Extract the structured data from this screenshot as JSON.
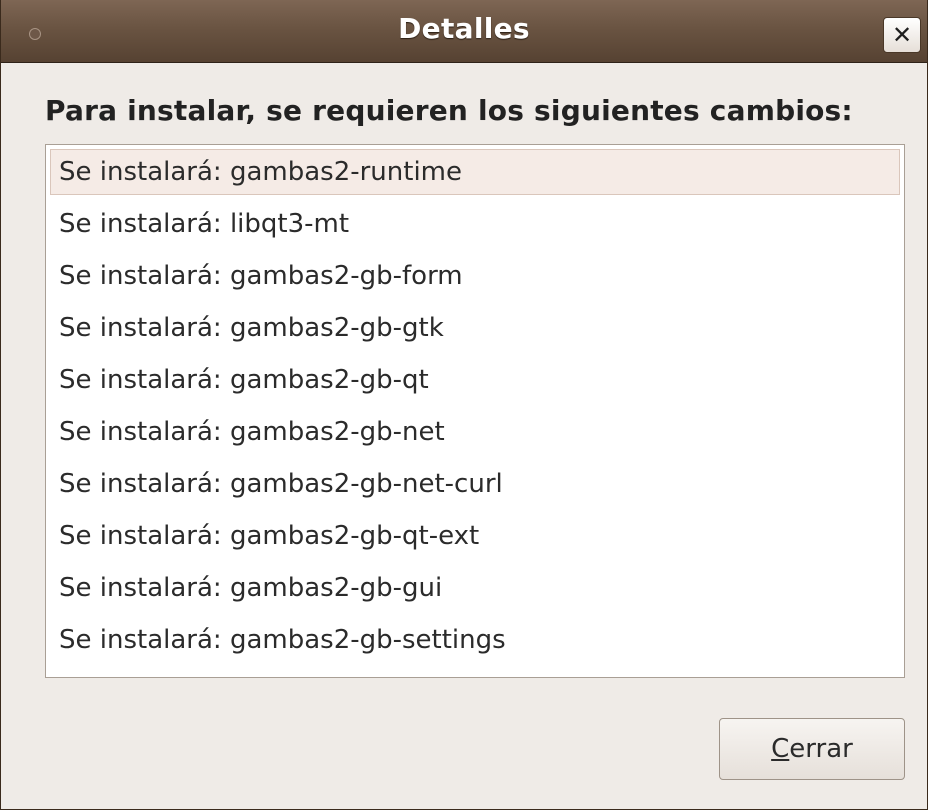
{
  "window": {
    "title": "Detalles",
    "close_symbol": "✕"
  },
  "heading": "Para instalar, se requieren los siguientes cambios:",
  "changes": [
    "Se instalará: gambas2-runtime",
    "Se instalará: libqt3-mt",
    "Se instalará: gambas2-gb-form",
    "Se instalará: gambas2-gb-gtk",
    "Se instalará: gambas2-gb-qt",
    "Se instalará: gambas2-gb-net",
    "Se instalará: gambas2-gb-net-curl",
    "Se instalará: gambas2-gb-qt-ext",
    "Se instalará: gambas2-gb-gui",
    "Se instalará: gambas2-gb-settings"
  ],
  "selected_index": 0,
  "close_button": {
    "mnemonic": "C",
    "rest": "errar"
  },
  "colors": {
    "titlebar": "#6a5442",
    "window_bg": "#efebe7",
    "selection": "#f5ebe6"
  },
  "icons": {
    "window_menu": "window-menu-icon",
    "close": "close-icon"
  }
}
